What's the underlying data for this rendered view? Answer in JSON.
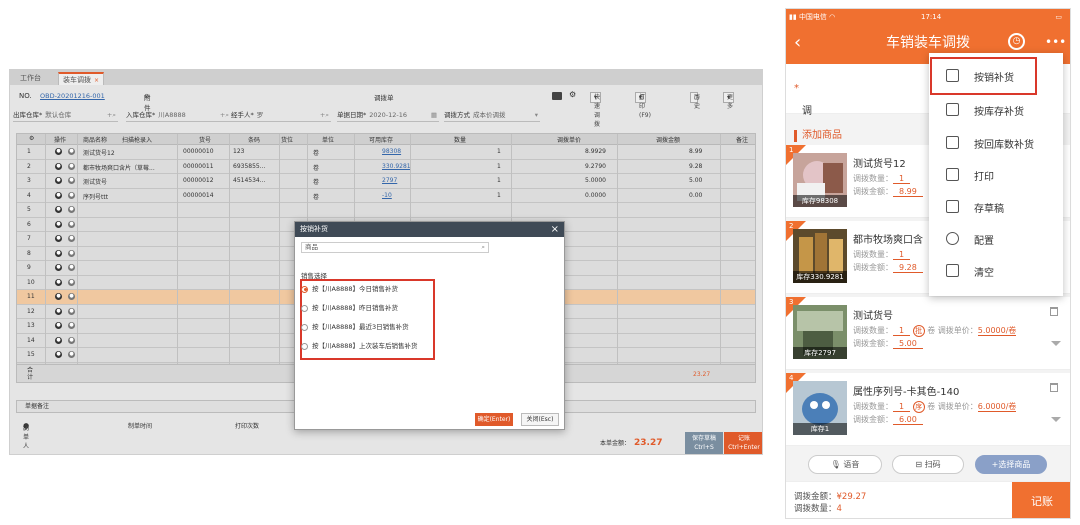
{
  "desktop": {
    "tabs": [
      "工作台",
      "装车调拨"
    ],
    "tab_close": "×",
    "order_label": "NO.",
    "order_no": "OBD-20201216-001",
    "attach": "附件",
    "doc_title": "调拨单",
    "buttons": [
      "快速调拨",
      "打印(F9)",
      "历史",
      "更多"
    ],
    "fields": [
      {
        "label": "出库仓库*",
        "value": "默认仓库"
      },
      {
        "label": "入库仓库*",
        "value": "川A8888"
      },
      {
        "label": "经手人*",
        "value": "罗"
      },
      {
        "label": "单据日期*",
        "value": "2020-12-16"
      },
      {
        "label": "调拨方式",
        "value": "成本价调拨"
      }
    ],
    "headers": [
      "操作",
      "商品名称",
      "扫描枪录入",
      "货号",
      "条码",
      "货位",
      "单位",
      "可用库存",
      "数量",
      "调拨单价",
      "调拨金额",
      "备注"
    ],
    "rows": [
      {
        "no": "1",
        "name": "测试货号12",
        "code": "00000010",
        "barcode": "123",
        "unit": "卷",
        "stock": "98308",
        "qty": "1",
        "price": "8.9929",
        "amount": "8.99"
      },
      {
        "no": "2",
        "name": "都市牧场爽口含片（草莓...",
        "code": "00000011",
        "barcode": "6935855...",
        "unit": "卷",
        "stock": "330.9281",
        "qty": "1",
        "price": "9.2790",
        "amount": "9.28"
      },
      {
        "no": "3",
        "name": "测试货号",
        "code": "00000012",
        "barcode": "4514534...",
        "unit": "卷",
        "stock": "2797",
        "qty": "1",
        "price": "5.0000",
        "amount": "5.00"
      },
      {
        "no": "4",
        "name": "序列号ttt",
        "code": "00000014",
        "barcode": "",
        "unit": "卷",
        "stock": "-10",
        "qty": "1",
        "price": "0.0000",
        "amount": "0.00"
      },
      {
        "no": "5"
      },
      {
        "no": "6"
      },
      {
        "no": "7"
      },
      {
        "no": "8"
      },
      {
        "no": "9"
      },
      {
        "no": "10"
      },
      {
        "no": "11"
      },
      {
        "no": "12"
      },
      {
        "no": "13"
      },
      {
        "no": "14"
      },
      {
        "no": "15"
      }
    ],
    "sum_label": "合计",
    "grid_total": "23.27",
    "remark_label": "单据备注",
    "maker_label": "制单人",
    "maker": "罗",
    "make_time_label": "制单时间",
    "print_count_label": "打印次数",
    "total_label": "本单金额：",
    "total_value": "23.27",
    "save_draft": "保存草稿",
    "save_draft_key": "Ctrl+S",
    "submit": "记账",
    "submit_key": "Ctrl+Enter"
  },
  "dialog": {
    "title": "按销补货",
    "close": "×",
    "search_placeholder": "商品",
    "section_label": "销售选择",
    "options": [
      "按【川A8888】今日销售补货",
      "按【川A8888】昨日销售补货",
      "按【川A8888】最近3日销售补货",
      "按【川A8888】上次装车后销售补货"
    ],
    "selected_index": 0,
    "ok": "确定(Enter)",
    "cancel": "关闭(Esc)"
  },
  "mobile": {
    "carrier": "中国电信",
    "time": "17:14",
    "title": "车销装车调拨",
    "warehouse_label": "调入仓库",
    "required_mark": "*",
    "add_label": "添加商品",
    "qty_label": "调拨数量：",
    "amount_label": "调拨金额：",
    "price_label": "调拨单价：",
    "items": [
      {
        "no": "1",
        "name": "测试货号12",
        "stock": "库存98308",
        "qty": "1",
        "amount": "8.99"
      },
      {
        "no": "2",
        "name": "都市牧场爽口含",
        "stock": "库存330.9281",
        "qty": "1",
        "amount": "9.28"
      },
      {
        "no": "3",
        "name": "测试货号",
        "stock": "库存2797",
        "qty": "1",
        "unit": "卷",
        "badge": "批",
        "price": "5.0000/卷",
        "amount": "5.00"
      },
      {
        "no": "4",
        "name": "属性序列号-卡其色-140",
        "stock": "库存1",
        "qty": "1",
        "unit": "卷",
        "badge": "序",
        "price": "6.0000/卷",
        "amount": "6.00"
      }
    ],
    "menu": [
      "按销补货",
      "按库存补货",
      "按回库数补货",
      "打印",
      "存草稿",
      "配置",
      "清空"
    ],
    "voice": "语音",
    "scan": "扫码",
    "select_goods": "+选择商品",
    "total_amount_label": "调拨金额：",
    "total_amount": "¥29.27",
    "total_qty_label": "调拨数量：",
    "total_qty": "4",
    "submit": "记账"
  }
}
